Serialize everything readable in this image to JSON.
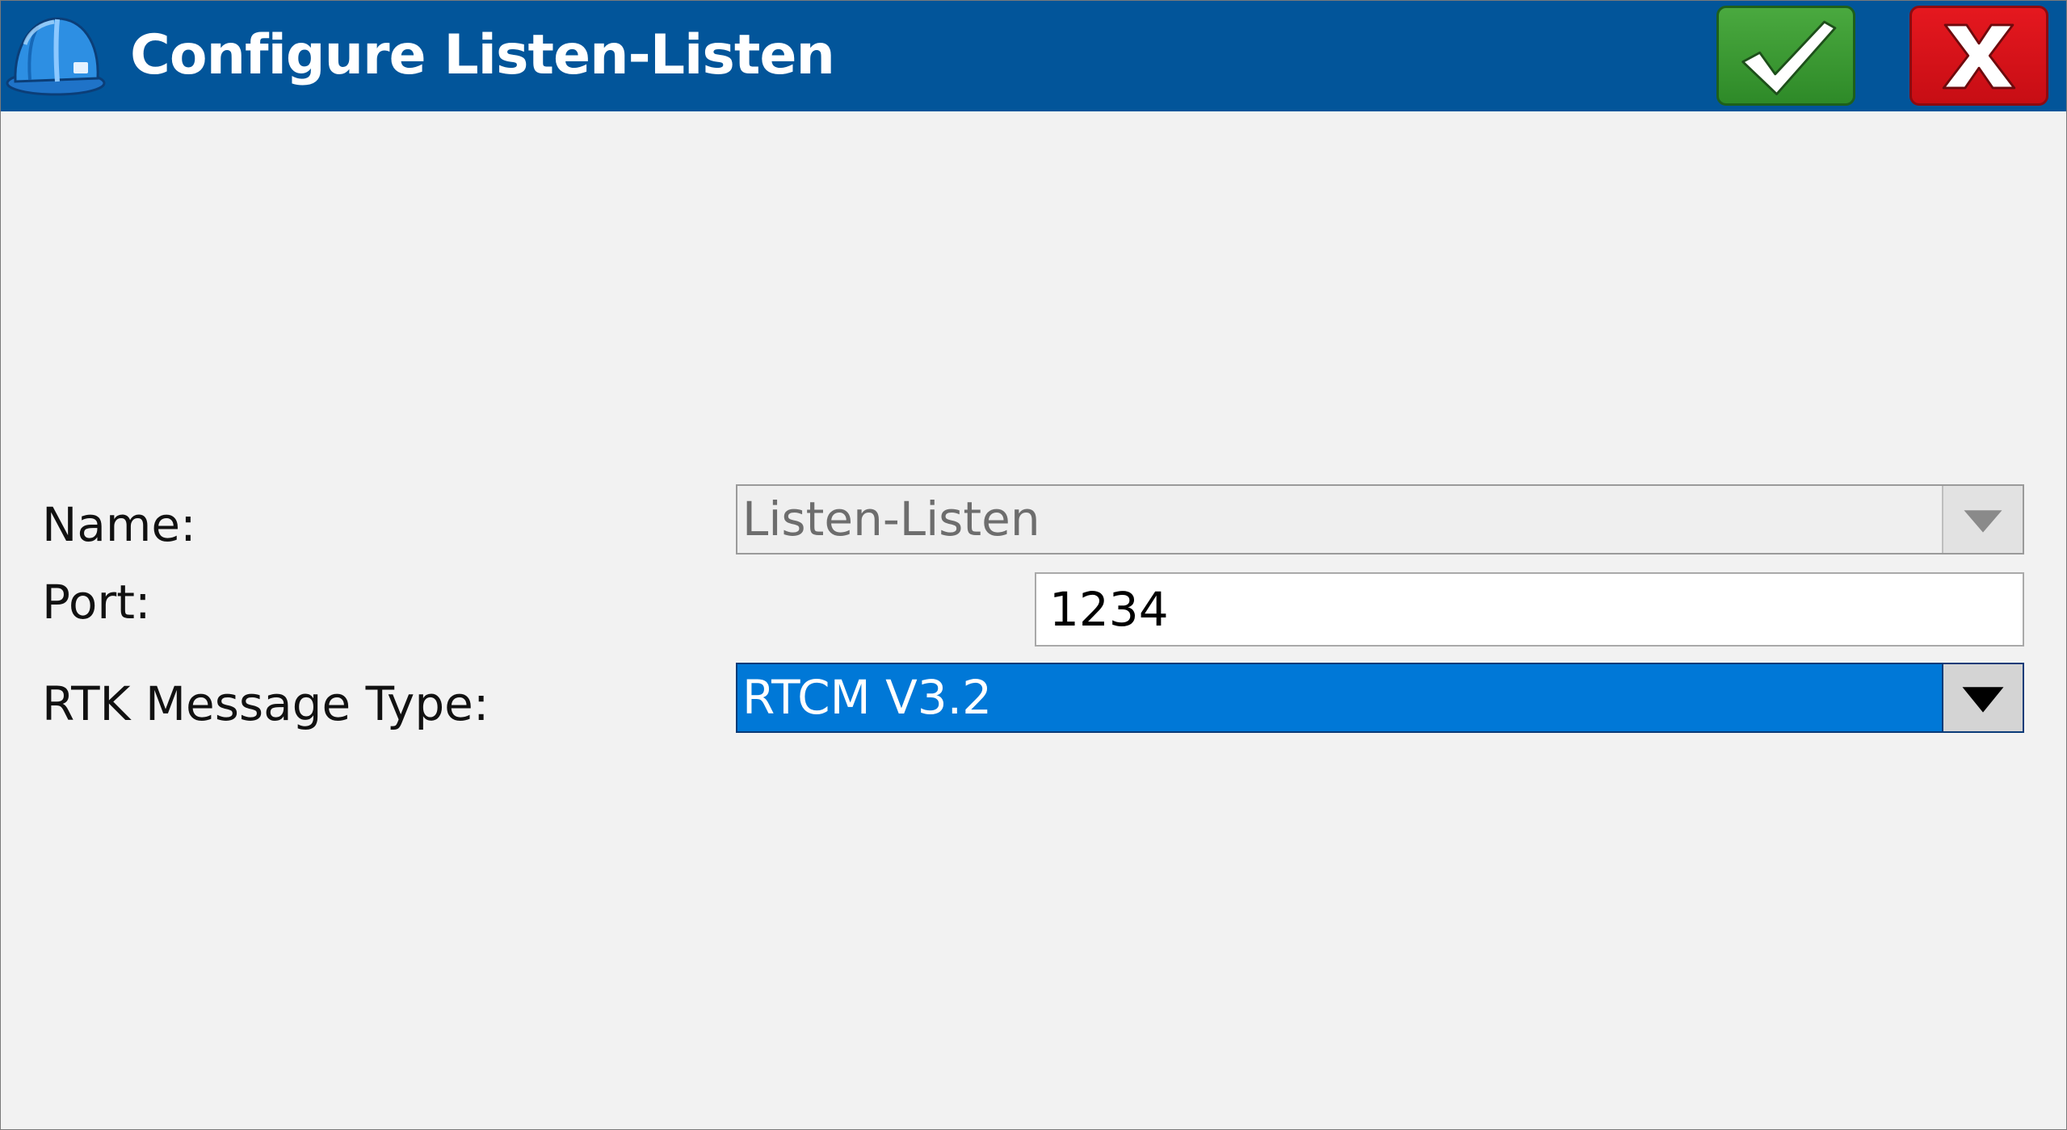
{
  "window": {
    "title": "Configure Listen-Listen",
    "app_icon": "hard-hat-icon",
    "ok_icon": "checkmark-icon",
    "cancel_icon": "close-x-icon",
    "colors": {
      "titlebar": "#02559a",
      "ok": "#3a9a33",
      "cancel": "#d9121a",
      "selection": "#0078d7",
      "background": "#f2f2f2"
    }
  },
  "form": {
    "name": {
      "label": "Name:",
      "value": "Listen-Listen"
    },
    "port": {
      "label": "Port:",
      "value": "1234"
    },
    "rtk_message_type": {
      "label": "RTK Message Type:",
      "value": "RTCM V3.2"
    }
  }
}
